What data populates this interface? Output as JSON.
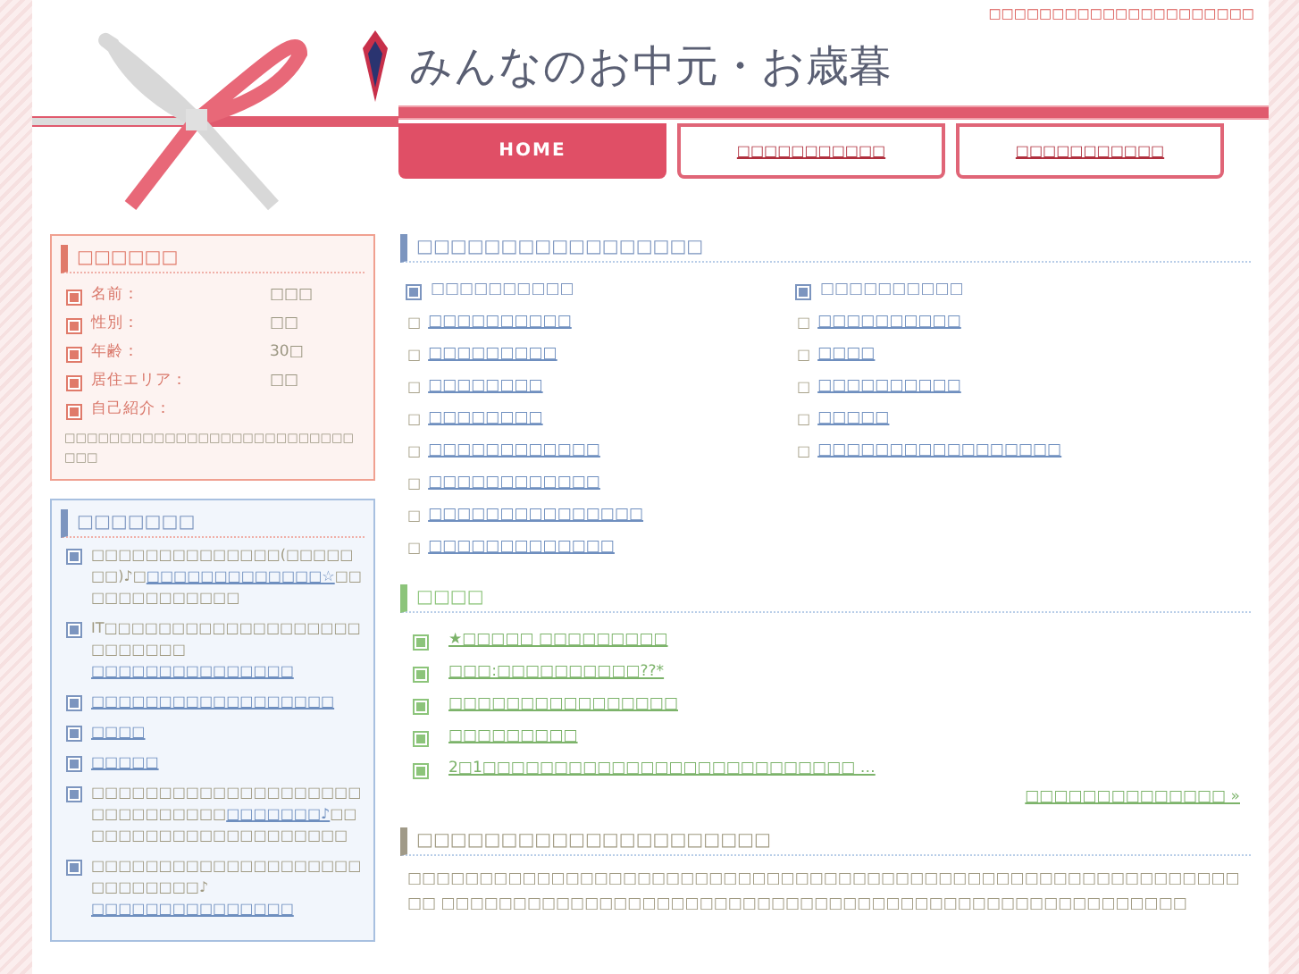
{
  "header": {
    "top_link": "□□□□□□□□□□□□□□□□□□□□□",
    "site_title": "みんなのお中元・お歳暮",
    "nav": [
      {
        "label": "HOME",
        "selected": true
      },
      {
        "label": "□□□□□□□□□□□",
        "selected": false
      },
      {
        "label": "□□□□□□□□□□□",
        "selected": false
      }
    ]
  },
  "profile": {
    "title": "□□□□□□",
    "fields": [
      {
        "label": "名前：",
        "value": "□□□"
      },
      {
        "label": "性別：",
        "value": "□□"
      },
      {
        "label": "年齢：",
        "value": "30□"
      },
      {
        "label": "居住エリア：",
        "value": "□□"
      },
      {
        "label": "自己紹介："
      }
    ],
    "intro": "□□□□□□□□□□□□□□□□□□□□□□□□□□□□□"
  },
  "comments": {
    "title": "□□□□□□□",
    "items": [
      {
        "before": "□□□□□□□□□□□□□□(□□□□□□□)♪□",
        "link": "□□□□□□□□□□□□□☆",
        "after": "□□□□□□□□□□□□□"
      },
      {
        "before": "IT□□□□□□□□□□□□□□□□□□□□□□□□□□",
        "link": "□□□□□□□□□□□□□□□"
      },
      {
        "link": "□□□□□□□□□□□□□□□□□□"
      },
      {
        "link": "□□□□"
      },
      {
        "link": "□□□□□"
      },
      {
        "before": "□□□□□□□□□□□□□□□□□□□□□□□□□□□□□□",
        "link": "□□□□□□□♪",
        "after": "□□□□□□□□□□□□□□□□□□□□□"
      },
      {
        "before": "□□□□□□□□□□□□□□□□□□□□□□□□□□□□♪",
        "link": "□□□□□□□□□□□□□□□"
      }
    ]
  },
  "categories": {
    "title": "□□□□□□□□□□□□□□□□□",
    "columns": [
      {
        "heading": "□□□□□□□□□□",
        "links": [
          {
            "bullet": "□",
            "text": "□□□□□□□□□□"
          },
          {
            "bullet": "□",
            "text": "□□□□□□□□□"
          },
          {
            "bullet": "□",
            "text": "□□□□□□□□"
          },
          {
            "bullet": "□",
            "text": "□□□□□□□□"
          },
          {
            "bullet": "□",
            "text": "□□□□□□□□□□□□"
          },
          {
            "bullet": "□",
            "text": "□□□□□□□□□□□□"
          },
          {
            "bullet": "□",
            "text": "□□□□□□□□□□□□□□□"
          },
          {
            "bullet": "□",
            "text": "□□□□□□□□□□□□□"
          }
        ]
      },
      {
        "heading": "□□□□□□□□□□",
        "links": [
          {
            "bullet": "□",
            "text": "□□□□□□□□□□"
          },
          {
            "bullet": "□",
            "text": "□□□□"
          },
          {
            "bullet": "□",
            "text": "□□□□□□□□□□"
          },
          {
            "bullet": "□",
            "text": "□□□□□"
          },
          {
            "bullet": "□",
            "text": "□□□□□□□□□□□□□□□□□"
          }
        ]
      }
    ]
  },
  "recent": {
    "title": "□□□□",
    "posts": [
      "★□□□□□ □□□□□□□□□",
      "□□□:□□□□□□□□□□??*",
      "□□□□□□□□□□□□□□□□",
      "□□□□□□□□□",
      "2□1□□□□□□□□□□□□□□□□□□□□□□□□□□ …"
    ],
    "more": "□□□□□□□□□□□□□□ »"
  },
  "about": {
    "title": "□□□□□□□□□□□□□□□□□□□□□",
    "text": "□□□□□□□□□□□□□□□□□□□□□□□□□□□□□□□□□□□□□□□□□□□□□□□□□□□□□□□□□□□□ □□□□□□□□□□□□□□□□□□□□□□□□□□□□□□□□□□□□□□□□□□□□□□□□□□□□"
  }
}
